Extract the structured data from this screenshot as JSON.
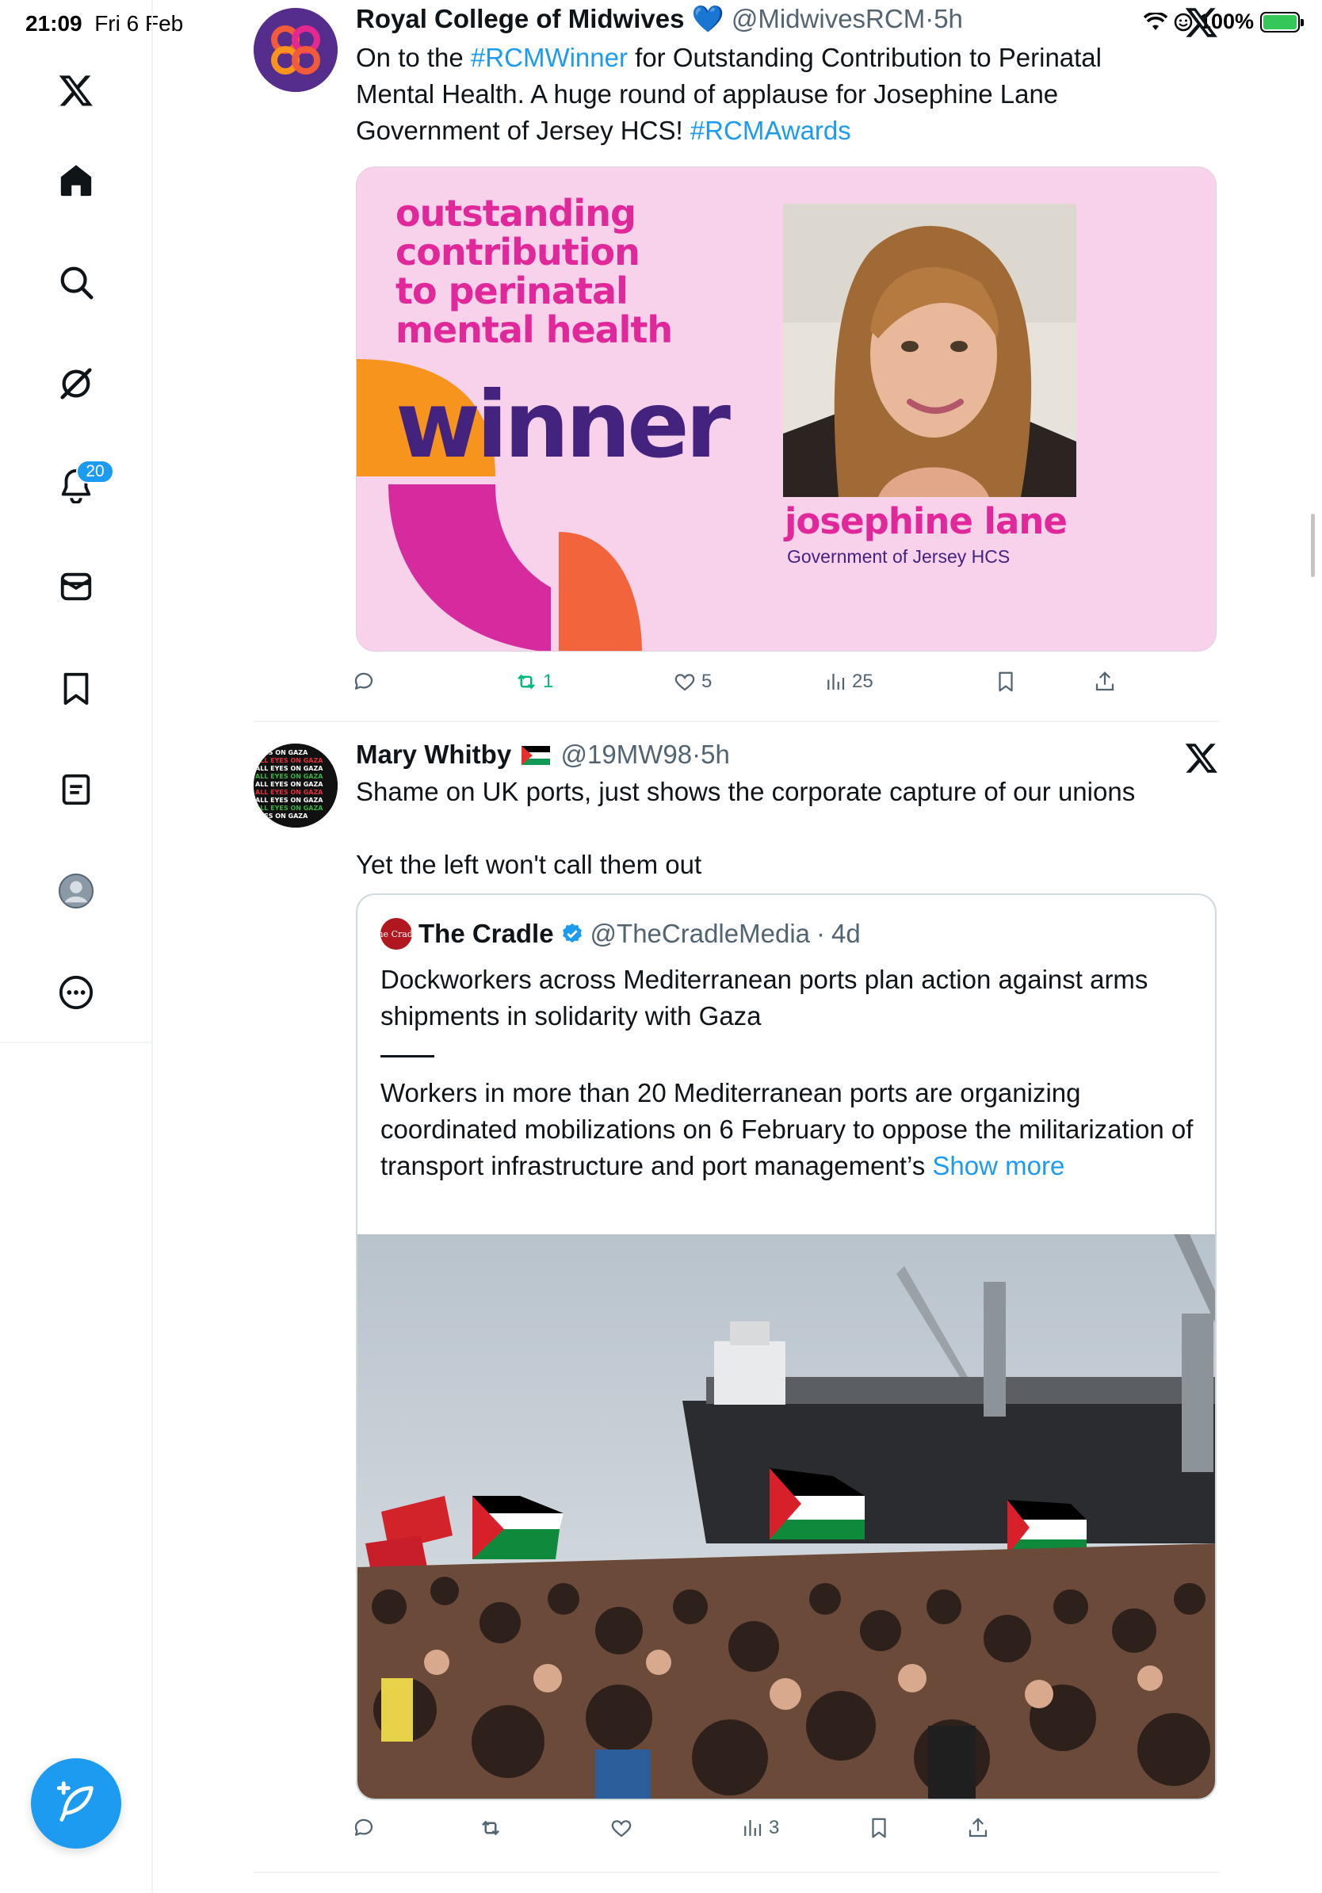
{
  "status_bar": {
    "time": "21:09",
    "date": "Fri 6 Feb",
    "battery_label": "100%",
    "battery_level": 1.0,
    "icons": [
      "wifi-icon",
      "focus-icon",
      "battery-charging-icon"
    ]
  },
  "sidebar": {
    "items": [
      {
        "name": "x-logo",
        "icon": "x-logo-icon"
      },
      {
        "name": "home",
        "icon": "home-icon"
      },
      {
        "name": "search",
        "icon": "search-icon"
      },
      {
        "name": "grok",
        "icon": "grok-icon"
      },
      {
        "name": "notifications",
        "icon": "bell-icon",
        "badge": "20"
      },
      {
        "name": "messages",
        "icon": "envelope-icon"
      },
      {
        "name": "bookmarks",
        "icon": "bookmark-icon"
      },
      {
        "name": "lists",
        "icon": "list-icon"
      },
      {
        "name": "profile",
        "icon": "profile-icon"
      },
      {
        "name": "more",
        "icon": "more-icon"
      }
    ],
    "compose_icon": "compose-feather-icon"
  },
  "tweet1": {
    "name": "Royal College of Midwives",
    "heart": "💙",
    "handle": "@MidwivesRCM",
    "dot": "·",
    "time": "5h",
    "text_part1": "On to the ",
    "hashtag1": "#RCMWinner",
    "text_part2": " for Outstanding Contribution to Perinatal Mental Health. A huge round of applause for Josephine Lane Government of Jersey HCS! ",
    "hashtag2": "#RCMAwards",
    "card": {
      "title": "outstanding\ncontribution\nto perinatal\nmental health",
      "winner": "winner",
      "person_name": "josephine lane",
      "organization": "Government of Jersey HCS",
      "colors": {
        "background": "#f8d2eb",
        "pink": "#e0289a",
        "purple": "#43237e",
        "orange": "#f7941d",
        "magenta": "#d62b9e",
        "coral": "#f2643c"
      }
    },
    "actions": {
      "reply": "",
      "retweet": "1",
      "like": "5",
      "views": "25"
    }
  },
  "tweet2": {
    "name": "Mary Whitby",
    "flag": "palestine-flag",
    "handle": "@19MW98",
    "dot": "·",
    "time": "5h",
    "avatar_text": "ALL EYES ON GAZA CITY",
    "line1": "Shame on UK ports, just shows the corporate capture of our unions",
    "line2": "Yet the left won't call them out",
    "quote": {
      "logo_text": "The Cradle",
      "name": "The Cradle",
      "verified": true,
      "handle": "@TheCradleMedia",
      "dot": "·",
      "time": "4d",
      "headline": "Dockworkers across Mediterranean ports plan action against arms shipments in solidarity with Gaza",
      "body": "Workers in more than 20 Mediterranean ports are organizing coordinated mobilizations on 6 February to oppose the militarization of transport infrastructure and port management’s",
      "show_more": "Show more"
    },
    "actions": {
      "reply": "",
      "retweet": "",
      "like": "",
      "views": "3"
    }
  }
}
